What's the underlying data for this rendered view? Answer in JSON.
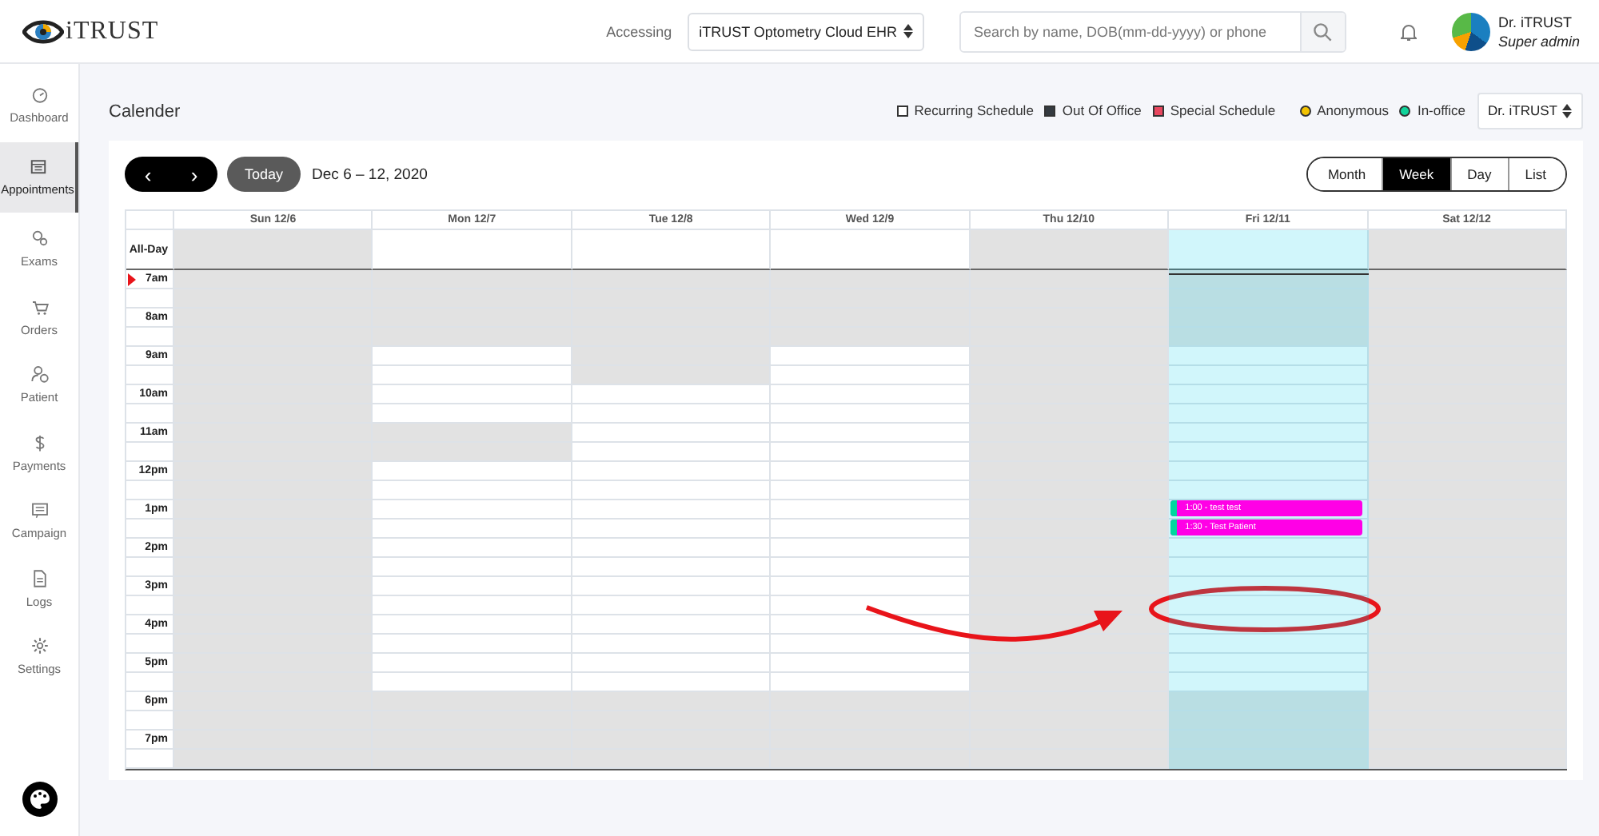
{
  "header": {
    "logo_text": "iTRUST",
    "accessing_label": "Accessing",
    "practice_select": "iTRUST Optometry Cloud EHR",
    "search": {
      "placeholder": "Search by name, DOB(mm-dd-yyyy) or phone"
    },
    "user": {
      "name": "Dr. iTRUST",
      "role": "Super admin"
    }
  },
  "sidebar": {
    "items": [
      {
        "label": "Dashboard",
        "selected": false
      },
      {
        "label": "Appointments",
        "selected": true
      },
      {
        "label": "Exams",
        "selected": false
      },
      {
        "label": "Orders",
        "selected": false
      },
      {
        "label": "Patient",
        "selected": false
      },
      {
        "label": "Payments",
        "selected": false
      },
      {
        "label": "Campaign",
        "selected": false
      },
      {
        "label": "Logs",
        "selected": false
      },
      {
        "label": "Settings",
        "selected": false
      }
    ]
  },
  "page_title": "Calender",
  "legend": [
    {
      "kind": "square",
      "label": "Recurring Schedule",
      "color": "#ffffff"
    },
    {
      "kind": "square",
      "label": "Out Of Office",
      "color": "#343a40"
    },
    {
      "kind": "square",
      "label": "Special Schedule",
      "color": "#e8475f"
    },
    {
      "kind": "dot",
      "label": "Anonymous",
      "color": "#f2c200"
    },
    {
      "kind": "dot",
      "label": "In-office",
      "color": "#10d39a"
    }
  ],
  "provider_select": "Dr. iTRUST",
  "toolbar": {
    "prev": "‹",
    "next": "›",
    "today": "Today",
    "range": "Dec 6 – 12, 2020"
  },
  "views": [
    {
      "label": "Month",
      "selected": false
    },
    {
      "label": "Week",
      "selected": true
    },
    {
      "label": "Day",
      "selected": false
    },
    {
      "label": "List",
      "selected": false
    }
  ],
  "calendar": {
    "days": [
      {
        "label": "Sun 12/6",
        "today": false
      },
      {
        "label": "Mon 12/7",
        "today": false
      },
      {
        "label": "Tue 12/8",
        "today": false
      },
      {
        "label": "Wed 12/9",
        "today": false
      },
      {
        "label": "Thu 12/10",
        "today": false
      },
      {
        "label": "Fri 12/11",
        "today": true
      },
      {
        "label": "Sat 12/12",
        "today": false
      }
    ],
    "all_day": {
      "label": "All-Day",
      "available": [
        false,
        true,
        true,
        true,
        false,
        true,
        false
      ]
    },
    "rows": [
      {
        "time": "7am",
        "now": true,
        "cells": [
          {
            "available": false
          },
          {
            "available": false
          },
          {
            "available": false
          },
          {
            "available": false
          },
          {
            "available": false
          },
          {
            "available": false
          },
          {
            "available": false
          }
        ]
      },
      {
        "now": false,
        "cells": [
          {
            "available": false
          },
          {
            "available": false
          },
          {
            "available": false
          },
          {
            "available": false
          },
          {
            "available": false
          },
          {
            "available": false
          },
          {
            "available": false
          }
        ]
      },
      {
        "time": "8am",
        "now": false,
        "cells": [
          {
            "available": false
          },
          {
            "available": false
          },
          {
            "available": false
          },
          {
            "available": false
          },
          {
            "available": false
          },
          {
            "available": false
          },
          {
            "available": false
          }
        ]
      },
      {
        "now": false,
        "cells": [
          {
            "available": false
          },
          {
            "available": false
          },
          {
            "available": false
          },
          {
            "available": false
          },
          {
            "available": false
          },
          {
            "available": false
          },
          {
            "available": false
          }
        ]
      },
      {
        "time": "9am",
        "now": false,
        "cells": [
          {
            "available": false
          },
          {
            "available": true
          },
          {
            "available": false
          },
          {
            "available": true
          },
          {
            "available": false
          },
          {
            "available": true
          },
          {
            "available": false
          }
        ]
      },
      {
        "now": false,
        "cells": [
          {
            "available": false
          },
          {
            "available": true
          },
          {
            "available": false
          },
          {
            "available": true
          },
          {
            "available": false
          },
          {
            "available": true
          },
          {
            "available": false
          }
        ]
      },
      {
        "time": "10am",
        "now": false,
        "cells": [
          {
            "available": false
          },
          {
            "available": true
          },
          {
            "available": true
          },
          {
            "available": true
          },
          {
            "available": false
          },
          {
            "available": true
          },
          {
            "available": false
          }
        ]
      },
      {
        "now": false,
        "cells": [
          {
            "available": false
          },
          {
            "available": true
          },
          {
            "available": true
          },
          {
            "available": true
          },
          {
            "available": false
          },
          {
            "available": true
          },
          {
            "available": false
          }
        ]
      },
      {
        "time": "11am",
        "now": false,
        "cells": [
          {
            "available": false
          },
          {
            "available": false
          },
          {
            "available": true
          },
          {
            "available": true
          },
          {
            "available": false
          },
          {
            "available": true
          },
          {
            "available": false
          }
        ]
      },
      {
        "now": false,
        "cells": [
          {
            "available": false
          },
          {
            "available": false
          },
          {
            "available": true
          },
          {
            "available": true
          },
          {
            "available": false
          },
          {
            "available": true
          },
          {
            "available": false
          }
        ]
      },
      {
        "time": "12pm",
        "now": false,
        "cells": [
          {
            "available": false
          },
          {
            "available": true
          },
          {
            "available": true
          },
          {
            "available": true
          },
          {
            "available": false
          },
          {
            "available": true
          },
          {
            "available": false
          }
        ]
      },
      {
        "now": false,
        "cells": [
          {
            "available": false
          },
          {
            "available": true
          },
          {
            "available": true
          },
          {
            "available": true
          },
          {
            "available": false
          },
          {
            "available": true
          },
          {
            "available": false
          }
        ]
      },
      {
        "time": "1pm",
        "now": false,
        "cells": [
          {
            "available": false
          },
          {
            "available": true
          },
          {
            "available": true
          },
          {
            "available": true
          },
          {
            "available": false
          },
          {
            "available": true,
            "event": {
              "text": "1:00 - test test",
              "color": "#ff00e6",
              "status": {
                "color": "#00d7a0"
              }
            }
          },
          {
            "available": false
          }
        ]
      },
      {
        "now": false,
        "cells": [
          {
            "available": false
          },
          {
            "available": true
          },
          {
            "available": true
          },
          {
            "available": true
          },
          {
            "available": false
          },
          {
            "available": true,
            "event": {
              "text": "1:30 - Test Patient",
              "color": "#ff00e6",
              "status": {
                "color": "#00d7a0"
              }
            }
          },
          {
            "available": false
          }
        ]
      },
      {
        "time": "2pm",
        "now": false,
        "cells": [
          {
            "available": false
          },
          {
            "available": true
          },
          {
            "available": true
          },
          {
            "available": true
          },
          {
            "available": false
          },
          {
            "available": true
          },
          {
            "available": false
          }
        ]
      },
      {
        "now": false,
        "cells": [
          {
            "available": false
          },
          {
            "available": true
          },
          {
            "available": true
          },
          {
            "available": true
          },
          {
            "available": false
          },
          {
            "available": true
          },
          {
            "available": false
          }
        ]
      },
      {
        "time": "3pm",
        "now": false,
        "cells": [
          {
            "available": false
          },
          {
            "available": true
          },
          {
            "available": true
          },
          {
            "available": true
          },
          {
            "available": false
          },
          {
            "available": true
          },
          {
            "available": false
          }
        ]
      },
      {
        "now": false,
        "cells": [
          {
            "available": false
          },
          {
            "available": true
          },
          {
            "available": true
          },
          {
            "available": true
          },
          {
            "available": false
          },
          {
            "available": true
          },
          {
            "available": false
          }
        ]
      },
      {
        "time": "4pm",
        "now": false,
        "cells": [
          {
            "available": false
          },
          {
            "available": true
          },
          {
            "available": true
          },
          {
            "available": true
          },
          {
            "available": false
          },
          {
            "available": true
          },
          {
            "available": false
          }
        ]
      },
      {
        "now": false,
        "cells": [
          {
            "available": false
          },
          {
            "available": true
          },
          {
            "available": true
          },
          {
            "available": true
          },
          {
            "available": false
          },
          {
            "available": true
          },
          {
            "available": false
          }
        ]
      },
      {
        "time": "5pm",
        "now": false,
        "cells": [
          {
            "available": false
          },
          {
            "available": true
          },
          {
            "available": true
          },
          {
            "available": true
          },
          {
            "available": false
          },
          {
            "available": true
          },
          {
            "available": false
          }
        ]
      },
      {
        "now": false,
        "cells": [
          {
            "available": false
          },
          {
            "available": true
          },
          {
            "available": true
          },
          {
            "available": true
          },
          {
            "available": false
          },
          {
            "available": true
          },
          {
            "available": false
          }
        ]
      },
      {
        "time": "6pm",
        "now": false,
        "cells": [
          {
            "available": false
          },
          {
            "available": false
          },
          {
            "available": false
          },
          {
            "available": false
          },
          {
            "available": false
          },
          {
            "available": false
          },
          {
            "available": false
          }
        ]
      },
      {
        "now": false,
        "cells": [
          {
            "available": false
          },
          {
            "available": false
          },
          {
            "available": false
          },
          {
            "available": false
          },
          {
            "available": false
          },
          {
            "available": false
          },
          {
            "available": false
          }
        ]
      },
      {
        "time": "7pm",
        "now": false,
        "cells": [
          {
            "available": false
          },
          {
            "available": false
          },
          {
            "available": false
          },
          {
            "available": false
          },
          {
            "available": false
          },
          {
            "available": false
          },
          {
            "available": false
          }
        ]
      },
      {
        "now": false,
        "cells": [
          {
            "available": false
          },
          {
            "available": false
          },
          {
            "available": false
          },
          {
            "available": false
          },
          {
            "available": false
          },
          {
            "available": false
          },
          {
            "available": false
          }
        ]
      }
    ]
  },
  "annotation": {
    "arrow": true,
    "ellipse": true
  }
}
